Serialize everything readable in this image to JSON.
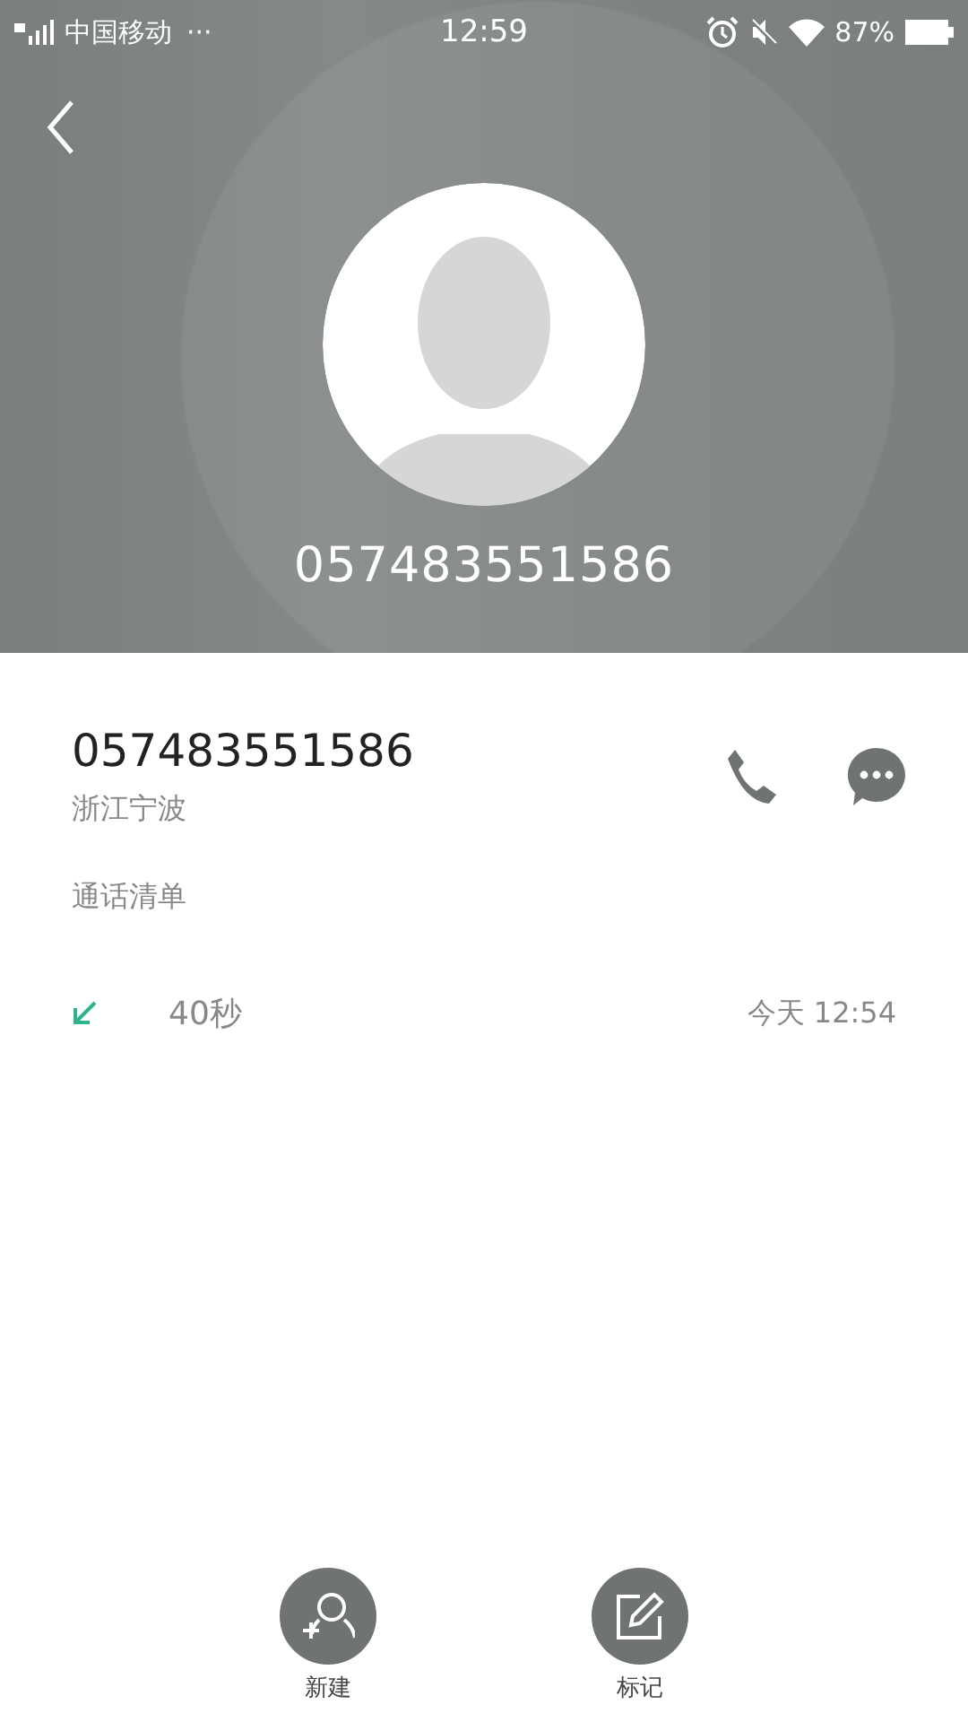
{
  "status_bar": {
    "carrier": "中国移动",
    "more": "···",
    "time": "12:59",
    "battery": "87%"
  },
  "header": {
    "number": "057483551586"
  },
  "contact": {
    "number": "057483551586",
    "location": "浙江宁波"
  },
  "call_log": {
    "title": "通话清单",
    "entries": [
      {
        "kind": "incoming",
        "duration": "40秒",
        "time": "今天 12:54"
      }
    ]
  },
  "actions": [
    {
      "kind": "new",
      "label": "新建"
    },
    {
      "kind": "mark",
      "label": "标记"
    }
  ]
}
